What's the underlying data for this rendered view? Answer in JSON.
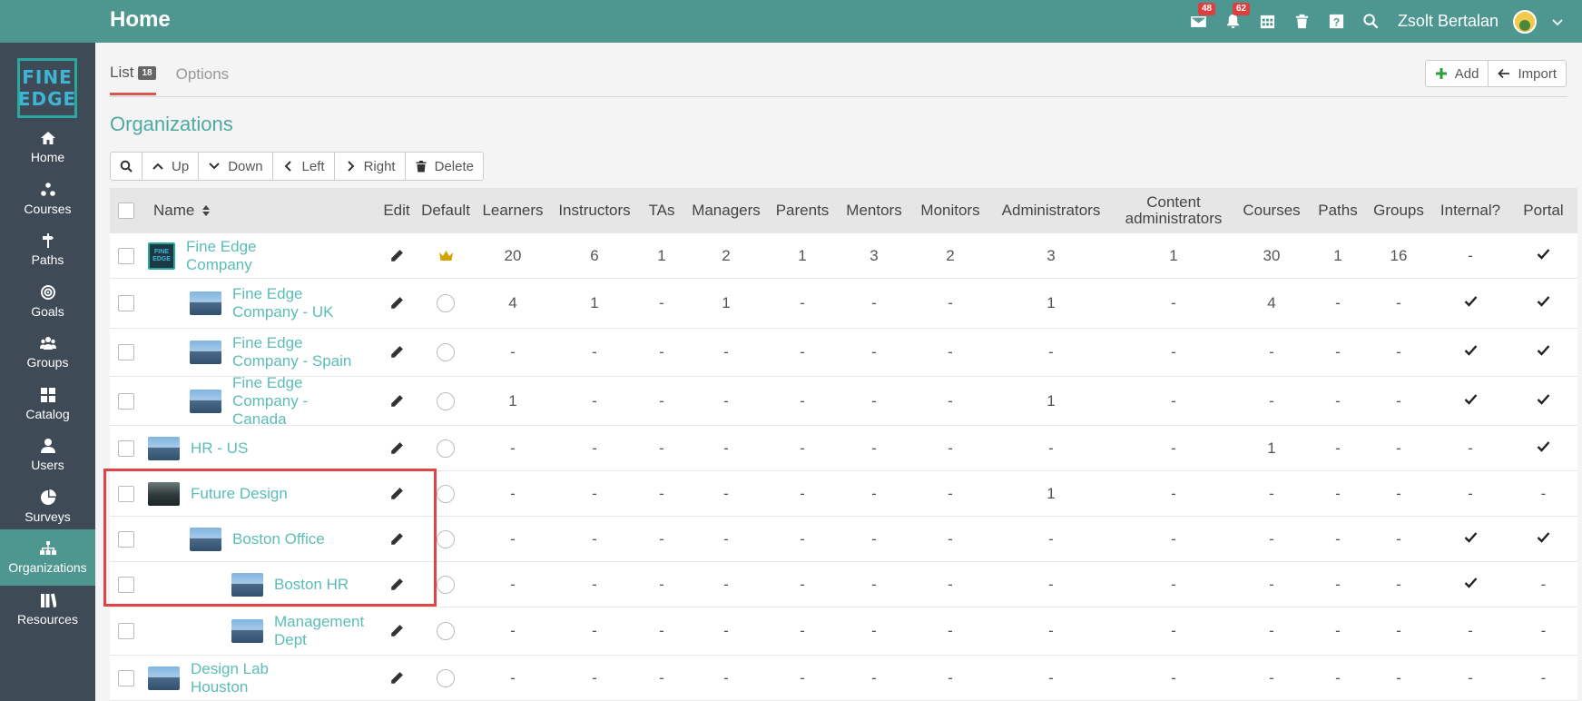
{
  "header": {
    "title": "Home",
    "messages_count": "48",
    "notifications_count": "62",
    "user_name": "Zsolt Bertalan"
  },
  "sidebar": {
    "logo_line1": "FINE",
    "logo_line2": "EDGE",
    "items": [
      {
        "label": "Home",
        "icon": "home-icon"
      },
      {
        "label": "Courses",
        "icon": "courses-icon"
      },
      {
        "label": "Paths",
        "icon": "paths-icon"
      },
      {
        "label": "Goals",
        "icon": "goals-icon"
      },
      {
        "label": "Groups",
        "icon": "groups-icon"
      },
      {
        "label": "Catalog",
        "icon": "catalog-icon"
      },
      {
        "label": "Users",
        "icon": "users-icon"
      },
      {
        "label": "Surveys",
        "icon": "surveys-icon"
      },
      {
        "label": "Organizations",
        "icon": "organizations-icon"
      },
      {
        "label": "Resources",
        "icon": "resources-icon"
      }
    ],
    "active": "Organizations"
  },
  "tabs": [
    {
      "label": "List",
      "count": "18"
    },
    {
      "label": "Options"
    }
  ],
  "actions": {
    "add": "Add",
    "import": "Import"
  },
  "section_title": "Organizations",
  "toolbar": {
    "up": "Up",
    "down": "Down",
    "left": "Left",
    "right": "Right",
    "delete": "Delete"
  },
  "columns": {
    "name": "Name",
    "edit": "Edit",
    "default": "Default",
    "learners": "Learners",
    "instructors": "Instructors",
    "tas": "TAs",
    "managers": "Managers",
    "parents": "Parents",
    "mentors": "Mentors",
    "monitors": "Monitors",
    "administrators": "Administrators",
    "content_line1": "Content",
    "content_line2": "administrators",
    "courses": "Courses",
    "paths": "Paths",
    "groups": "Groups",
    "internal": "Internal?",
    "portal": "Portal"
  },
  "rows": [
    {
      "name": "Fine Edge Company",
      "level": 0,
      "thumb": "logo",
      "default": "crown",
      "learners": "20",
      "instructors": "6",
      "tas": "1",
      "managers": "2",
      "parents": "1",
      "mentors": "3",
      "monitors": "2",
      "administrators": "3",
      "content": "1",
      "courses": "30",
      "paths": "1",
      "groups": "16",
      "internal": "-",
      "portal": "check"
    },
    {
      "name": "Fine Edge Company - UK",
      "level": 1,
      "thumb": "building",
      "default": "radio",
      "learners": "4",
      "instructors": "1",
      "tas": "-",
      "managers": "1",
      "parents": "-",
      "mentors": "-",
      "monitors": "-",
      "administrators": "1",
      "content": "-",
      "courses": "4",
      "paths": "-",
      "groups": "-",
      "internal": "check",
      "portal": "check"
    },
    {
      "name": "Fine Edge Company - Spain",
      "level": 1,
      "thumb": "building",
      "default": "radio",
      "learners": "-",
      "instructors": "-",
      "tas": "-",
      "managers": "-",
      "parents": "-",
      "mentors": "-",
      "monitors": "-",
      "administrators": "-",
      "content": "-",
      "courses": "-",
      "paths": "-",
      "groups": "-",
      "internal": "check",
      "portal": "check"
    },
    {
      "name": "Fine Edge Company - Canada",
      "level": 1,
      "thumb": "building",
      "default": "radio",
      "learners": "1",
      "instructors": "-",
      "tas": "-",
      "managers": "-",
      "parents": "-",
      "mentors": "-",
      "monitors": "-",
      "administrators": "1",
      "content": "-",
      "courses": "-",
      "paths": "-",
      "groups": "-",
      "internal": "check",
      "portal": "check"
    },
    {
      "name": "HR - US",
      "level": 0,
      "thumb": "building",
      "default": "radio",
      "learners": "-",
      "instructors": "-",
      "tas": "-",
      "managers": "-",
      "parents": "-",
      "mentors": "-",
      "monitors": "-",
      "administrators": "-",
      "content": "-",
      "courses": "1",
      "paths": "-",
      "groups": "-",
      "internal": "-",
      "portal": "check"
    },
    {
      "name": "Future Design",
      "level": 0,
      "thumb": "dark",
      "default": "radio",
      "learners": "-",
      "instructors": "-",
      "tas": "-",
      "managers": "-",
      "parents": "-",
      "mentors": "-",
      "monitors": "-",
      "administrators": "1",
      "content": "-",
      "courses": "-",
      "paths": "-",
      "groups": "-",
      "internal": "-",
      "portal": "-"
    },
    {
      "name": "Boston Office",
      "level": 1,
      "thumb": "building",
      "default": "radio",
      "learners": "-",
      "instructors": "-",
      "tas": "-",
      "managers": "-",
      "parents": "-",
      "mentors": "-",
      "monitors": "-",
      "administrators": "-",
      "content": "-",
      "courses": "-",
      "paths": "-",
      "groups": "-",
      "internal": "check",
      "portal": "check"
    },
    {
      "name": "Boston HR",
      "level": 2,
      "thumb": "building",
      "default": "radio",
      "learners": "-",
      "instructors": "-",
      "tas": "-",
      "managers": "-",
      "parents": "-",
      "mentors": "-",
      "monitors": "-",
      "administrators": "-",
      "content": "-",
      "courses": "-",
      "paths": "-",
      "groups": "-",
      "internal": "check",
      "portal": "-"
    },
    {
      "name": "Management Dept",
      "level": 2,
      "thumb": "building",
      "default": "radio",
      "learners": "-",
      "instructors": "-",
      "tas": "-",
      "managers": "-",
      "parents": "-",
      "mentors": "-",
      "monitors": "-",
      "administrators": "-",
      "content": "-",
      "courses": "-",
      "paths": "-",
      "groups": "-",
      "internal": "-",
      "portal": "-"
    },
    {
      "name": "Design Lab Houston",
      "level": 0,
      "thumb": "building",
      "default": "radio",
      "learners": "-",
      "instructors": "-",
      "tas": "-",
      "managers": "-",
      "parents": "-",
      "mentors": "-",
      "monitors": "-",
      "administrators": "-",
      "content": "-",
      "courses": "-",
      "paths": "-",
      "groups": "-",
      "internal": "-",
      "portal": "-"
    }
  ]
}
